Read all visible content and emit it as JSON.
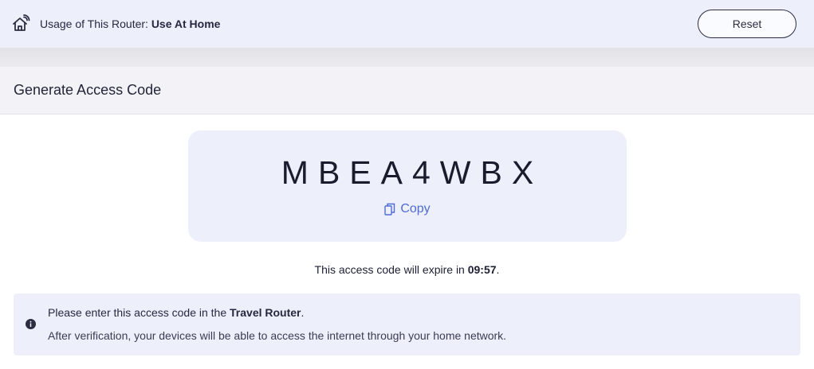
{
  "topbar": {
    "icon": "home-wifi-icon",
    "usage_label": "Usage of This Router:",
    "usage_value": "Use At Home",
    "reset_label": "Reset"
  },
  "section": {
    "title": "Generate Access Code"
  },
  "access_code": {
    "code": "MBEA4WBX",
    "copy_icon": "copy-icon",
    "copy_label": "Copy"
  },
  "expiry": {
    "prefix": "This access code will expire in",
    "time": "09:57",
    "suffix": "."
  },
  "info": {
    "icon": "info-icon",
    "line1_prefix": "Please enter this access code in the",
    "line1_bold": "Travel Router",
    "line1_suffix": ".",
    "line2": "After verification, your devices will be able to access the internet through your home network."
  },
  "colors": {
    "panel_bg": "#edf0fb",
    "accent": "#4f6bd6",
    "text_dark": "#1d1f33"
  }
}
